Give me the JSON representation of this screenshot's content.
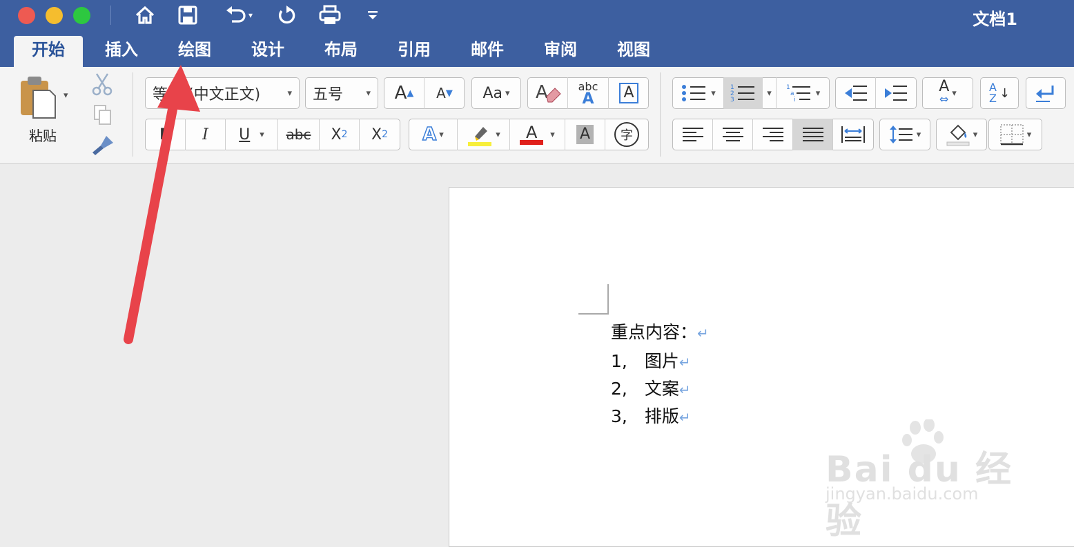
{
  "window": {
    "title": "文档1"
  },
  "colors": {
    "titlebar": "#3d5fa0",
    "accent": "#2a5399",
    "annotation_arrow": "#e8434a"
  },
  "quick_access": {
    "icons": [
      "home-icon",
      "save-icon",
      "undo-icon",
      "redo-icon",
      "print-icon",
      "customize-icon"
    ]
  },
  "tabs": [
    {
      "label": "开始",
      "active": true
    },
    {
      "label": "插入"
    },
    {
      "label": "绘图"
    },
    {
      "label": "设计"
    },
    {
      "label": "布局"
    },
    {
      "label": "引用"
    },
    {
      "label": "邮件"
    },
    {
      "label": "审阅"
    },
    {
      "label": "视图"
    }
  ],
  "ribbon": {
    "paste_label": "粘贴",
    "font_name": "等线 (中文正文)",
    "font_size": "五号",
    "bold": "B",
    "italic": "I",
    "underline": "U",
    "strike": "abc",
    "sub": "X",
    "sub_mark": "2",
    "sup": "X",
    "sup_mark": "2",
    "grow": "A",
    "shrink": "A",
    "change_case": "Aa",
    "phonetic": "abc",
    "phonetic_a": "A",
    "box_a": "A",
    "effect_a": "A",
    "font_color_a": "A",
    "shade_a": "A",
    "enclose_char": "字",
    "sort_a": "A",
    "sort_z": "Z"
  },
  "document": {
    "lines": [
      {
        "text": "重点内容："
      },
      {
        "text": "1,　图片"
      },
      {
        "text": "2,　文案"
      },
      {
        "text": "3,　排版"
      }
    ],
    "return_mark": "↵"
  },
  "watermark": {
    "brand": "Bai du 经验",
    "url": "jingyan.baidu.com"
  }
}
